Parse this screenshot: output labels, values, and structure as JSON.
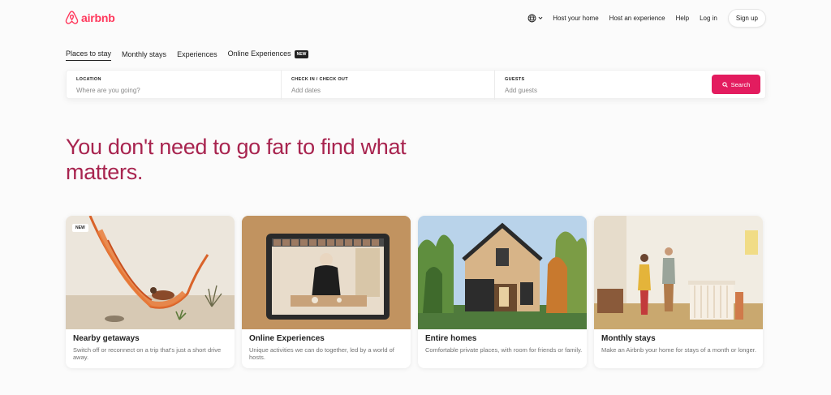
{
  "brand": {
    "name": "airbnb",
    "color": "#ff385c"
  },
  "header": {
    "language_icon": "globe-icon",
    "links": [
      "Host your home",
      "Host an experience",
      "Help",
      "Log in"
    ],
    "signup_label": "Sign up"
  },
  "tabs": [
    {
      "label": "Places to stay",
      "active": true
    },
    {
      "label": "Monthly stays",
      "active": false
    },
    {
      "label": "Experiences",
      "active": false
    },
    {
      "label": "Online Experiences",
      "active": false,
      "badge": "NEW"
    }
  ],
  "search": {
    "location": {
      "label": "LOCATION",
      "placeholder": "Where are you going?"
    },
    "dates": {
      "label": "CHECK IN / CHECK OUT",
      "placeholder": "Add dates"
    },
    "guests": {
      "label": "GUESTS",
      "placeholder": "Add guests"
    },
    "button_label": "Search",
    "button_icon": "search-icon",
    "button_color": "#e31c5f"
  },
  "hero": {
    "title": "You don't need to go far to find what matters."
  },
  "cards": [
    {
      "title": "Nearby getaways",
      "description": "Switch off or reconnect on a trip that's just a short drive away.",
      "badge": "NEW"
    },
    {
      "title": "Online Experiences",
      "description": "Unique activities we can do together, led by a world of hosts."
    },
    {
      "title": "Entire homes",
      "description": "Comfortable private places, with room for friends or family."
    },
    {
      "title": "Monthly stays",
      "description": "Make an Airbnb your home for stays of a month or longer."
    }
  ]
}
